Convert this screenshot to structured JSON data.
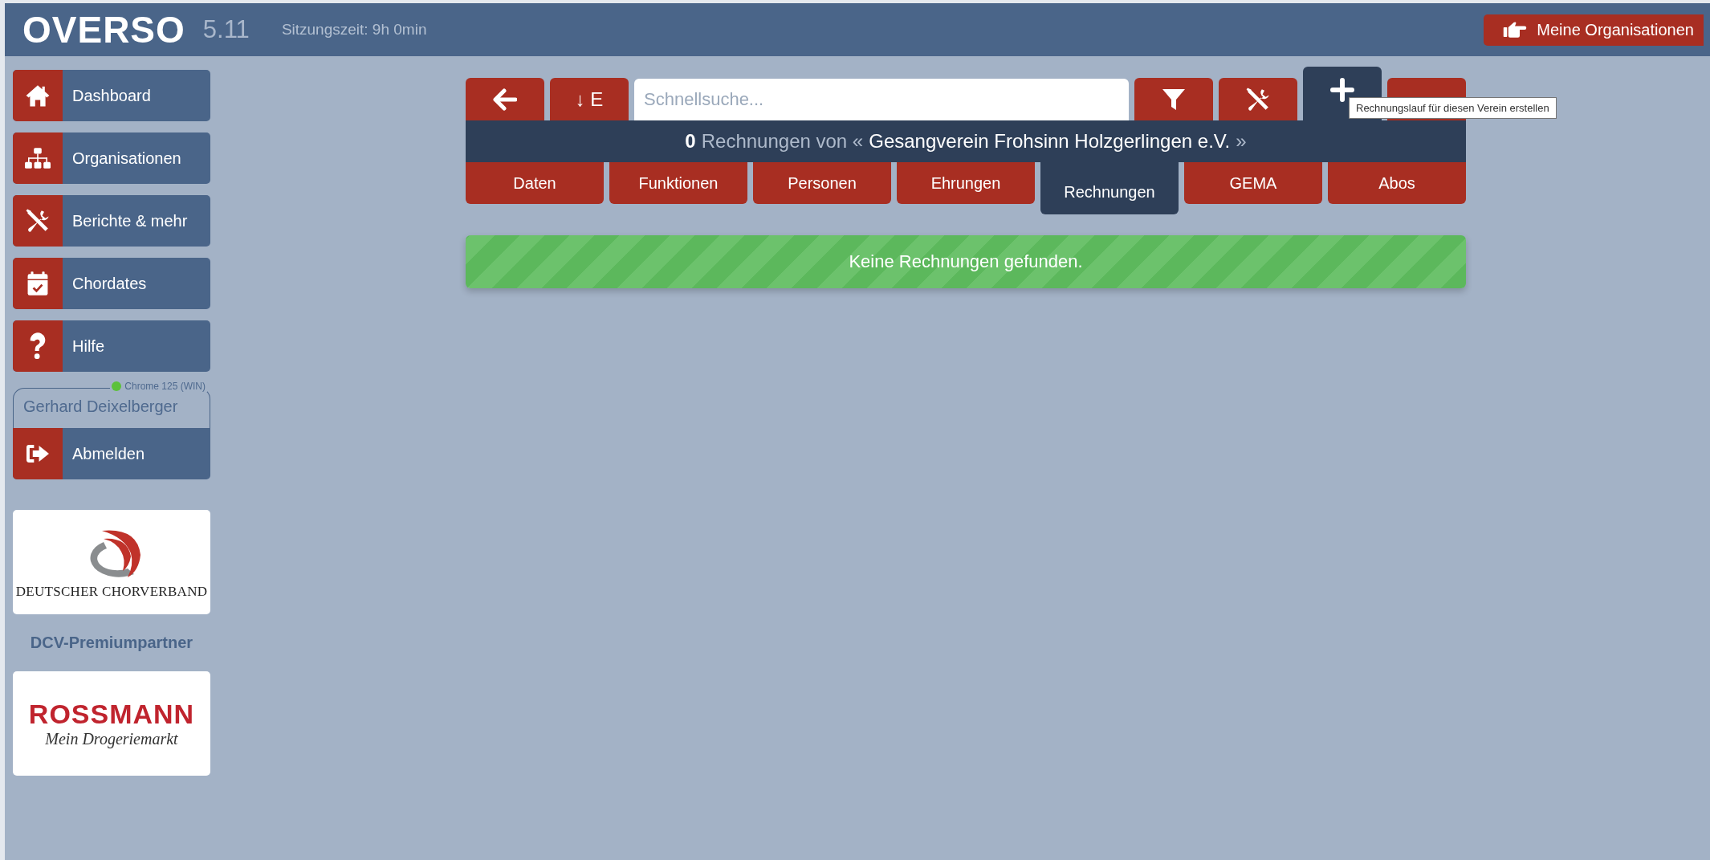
{
  "header": {
    "logo": "OVERSO",
    "version": "5.11",
    "session": "Sitzungszeit: 9h 0min",
    "org_button": "Meine Organisationen"
  },
  "sidebar": {
    "nav": [
      {
        "label": "Dashboard"
      },
      {
        "label": "Organisationen"
      },
      {
        "label": "Berichte & mehr"
      },
      {
        "label": "Chordates"
      },
      {
        "label": "Hilfe"
      }
    ],
    "user": {
      "client": "Chrome 125 (WIN)",
      "name": "Gerhard Deixelberger"
    },
    "logout": "Abmelden",
    "partners": [
      {
        "kind": "dcv",
        "text": "DEUTSCHER CHORVERBAND"
      },
      {
        "kind": "rossmann",
        "text": "ROSSMANN",
        "tagline": "Mein Drogeriemarkt"
      }
    ],
    "partner_label": "DCV-Premiumpartner"
  },
  "toolbar": [
    {
      "kind": "back",
      "hovered": false
    },
    {
      "kind": "sort",
      "label": "↓ E",
      "hovered": false
    },
    {
      "kind": "search",
      "placeholder": "Schnellsuche..."
    },
    {
      "kind": "filter",
      "hovered": false
    },
    {
      "kind": "tools",
      "hovered": false
    },
    {
      "kind": "add",
      "hovered": true
    },
    {
      "kind": "text",
      "hovered": false
    }
  ],
  "tooltip": "Rechnungslauf für diesen Verein erstellen",
  "title": {
    "count": "0",
    "prefix": "Rechnungen von «",
    "name": "Gesangverein Frohsinn Holzgerlingen e.V.",
    "suffix": "»"
  },
  "tabs": [
    {
      "label": "Daten",
      "selected": false
    },
    {
      "label": "Funktionen",
      "selected": false
    },
    {
      "label": "Personen",
      "selected": false
    },
    {
      "label": "Ehrungen",
      "selected": false
    },
    {
      "label": "Rechnungen",
      "selected": true
    },
    {
      "label": "GEMA",
      "selected": false
    },
    {
      "label": "Abos",
      "selected": false
    }
  ],
  "alert": {
    "kind": "success",
    "text": "Keine Rechnungen gefunden."
  }
}
